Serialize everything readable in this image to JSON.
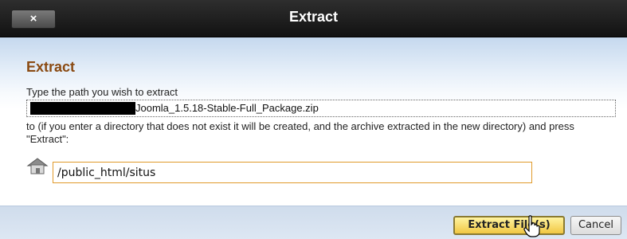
{
  "dialog": {
    "title": "Extract",
    "close_label": "×"
  },
  "content": {
    "heading": "Extract",
    "instruction": "Type the path you wish to extract",
    "archive_name": "Joomla_1.5.18-Stable-Full_Package.zip",
    "explanation": "to (if you enter a directory that does not exist it will be created, and the archive extracted in the new directory) and press \"Extract\":",
    "path_value": "/public_html/situs"
  },
  "buttons": {
    "extract_label": "Extract File(s)",
    "cancel_label": "Cancel"
  },
  "icons": {
    "close": "close-icon",
    "home": "home-icon",
    "cursor": "hand-pointer-icon"
  },
  "colors": {
    "heading": "#8a4a12",
    "input_border": "#e09a2a",
    "extract_button": "#f1c743"
  }
}
